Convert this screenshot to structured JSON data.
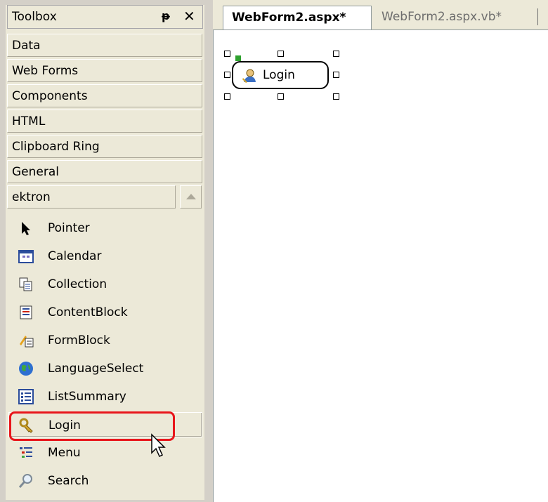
{
  "toolbox": {
    "title": "Toolbox",
    "pin_icon": "pin-icon",
    "close_icon": "close-icon",
    "tabs": [
      {
        "label": "Data"
      },
      {
        "label": "Web Forms"
      },
      {
        "label": "Components"
      },
      {
        "label": "HTML"
      },
      {
        "label": "Clipboard Ring"
      },
      {
        "label": "General"
      },
      {
        "label": "ektron"
      }
    ],
    "items": [
      {
        "label": "Pointer",
        "icon": "pointer-icon"
      },
      {
        "label": "Calendar",
        "icon": "calendar-icon"
      },
      {
        "label": "Collection",
        "icon": "collection-icon"
      },
      {
        "label": "ContentBlock",
        "icon": "content-block-icon"
      },
      {
        "label": "FormBlock",
        "icon": "form-block-icon"
      },
      {
        "label": "LanguageSelect",
        "icon": "globe-icon"
      },
      {
        "label": "ListSummary",
        "icon": "list-summary-icon"
      },
      {
        "label": "Login",
        "icon": "keys-icon"
      },
      {
        "label": "Menu",
        "icon": "menu-icon"
      },
      {
        "label": "Search",
        "icon": "magnifier-icon"
      }
    ]
  },
  "editor": {
    "tabs": [
      {
        "label": "WebForm2.aspx*",
        "active": true
      },
      {
        "label": "WebForm2.aspx.vb*",
        "active": false
      }
    ],
    "control_label": "Login"
  },
  "colors": {
    "highlight": "#e8161b",
    "panel_bg": "#ece9d8",
    "surface_bg": "#ffffff"
  }
}
